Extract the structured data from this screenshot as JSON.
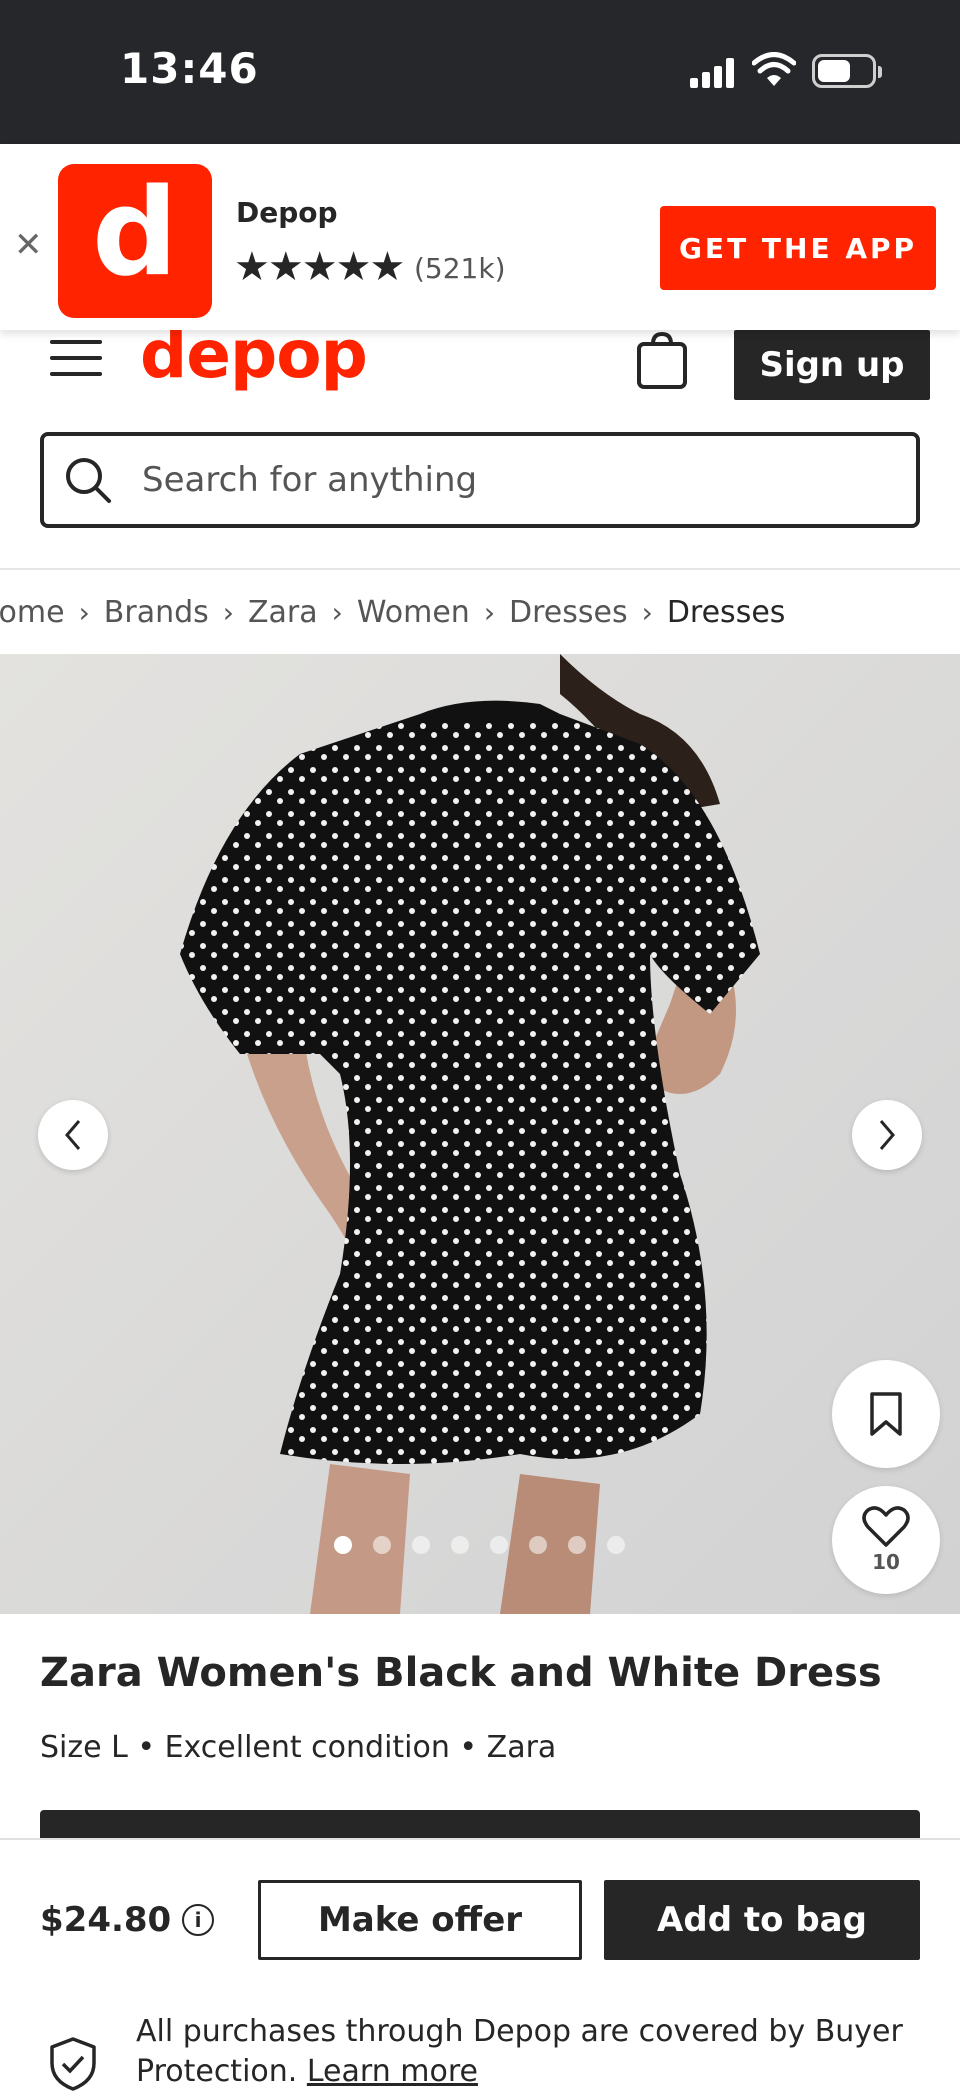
{
  "status_bar": {
    "time": "13:46"
  },
  "app_banner": {
    "close_icon": "close-icon",
    "logo_letter": "d",
    "app_name": "Depop",
    "stars": "★★★★★",
    "review_count": "(521k)",
    "cta_label": "GET THE APP",
    "accent": "#ff2300"
  },
  "header": {
    "brand": "depop",
    "signup_label": "Sign up"
  },
  "search": {
    "placeholder": "Search for anything"
  },
  "breadcrumb": [
    "Home",
    "Brands",
    "Zara",
    "Women",
    "Dresses",
    "Dresses"
  ],
  "gallery": {
    "total_images": 8,
    "active_index": 0,
    "like_count": "10"
  },
  "product": {
    "title": "Zara Women's Black and White Dress",
    "meta": "Size L • Excellent condition • Zara"
  },
  "buy_bar": {
    "price": "$24.80",
    "info_icon": "i",
    "offer_label": "Make offer",
    "add_label": "Add to bag",
    "protection_text": "All purchases through Depop are covered by Buyer Protection.",
    "learn_more": "Learn more"
  }
}
